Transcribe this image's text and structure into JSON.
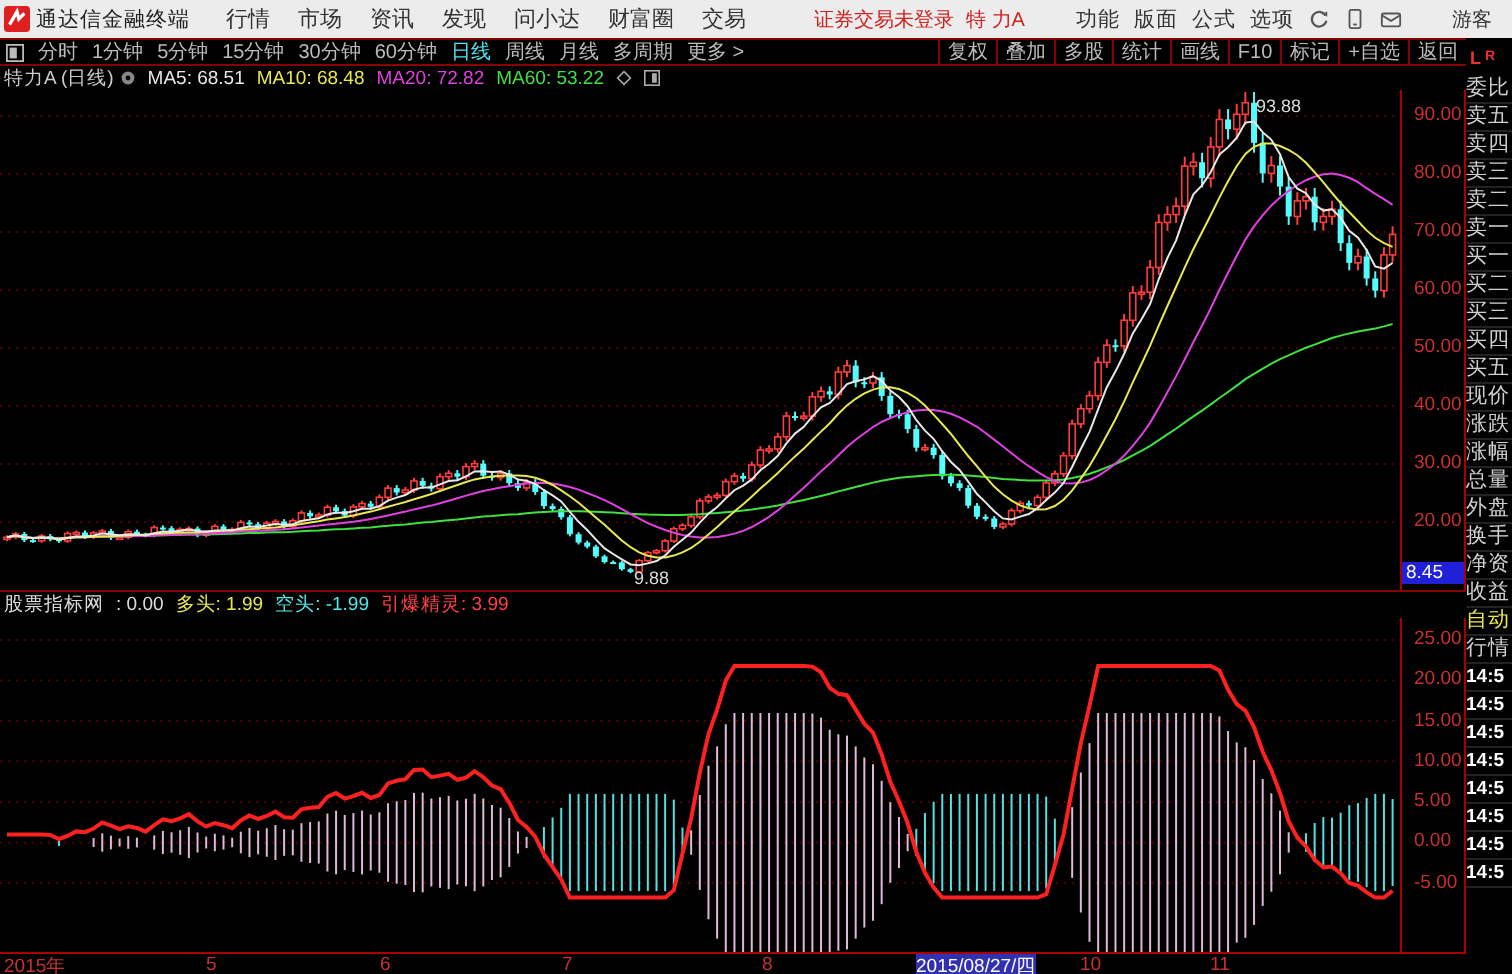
{
  "app": {
    "title": "通达信金融终端"
  },
  "menu": [
    "行情",
    "市场",
    "资讯",
    "发现",
    "问小达",
    "财富圈",
    "交易"
  ],
  "login_status": "证券交易未登录",
  "stock_name": "特 力A",
  "system_menu": [
    "功能",
    "版面",
    "公式",
    "选项"
  ],
  "user": "游客",
  "period_tabs": [
    {
      "label": "分时",
      "selected": false
    },
    {
      "label": "1分钟",
      "selected": false
    },
    {
      "label": "5分钟",
      "selected": false
    },
    {
      "label": "15分钟",
      "selected": false
    },
    {
      "label": "30分钟",
      "selected": false
    },
    {
      "label": "60分钟",
      "selected": false
    },
    {
      "label": "日线",
      "selected": true
    },
    {
      "label": "周线",
      "selected": false
    },
    {
      "label": "月线",
      "selected": false
    },
    {
      "label": "多周期",
      "selected": false
    },
    {
      "label": "更多 >",
      "selected": false
    }
  ],
  "tools": [
    "复权",
    "叠加",
    "多股",
    "统计",
    "画线",
    "F10",
    "标记",
    "+自选",
    "返回"
  ],
  "chart_title": "特力A (日线)",
  "moving_averages": [
    {
      "label": "MA5: 68.51",
      "color": "#e8e8e8"
    },
    {
      "label": "MA10: 68.48",
      "color": "#e8e850"
    },
    {
      "label": "MA20: 72.82",
      "color": "#e040e0"
    },
    {
      "label": "MA60: 53.22",
      "color": "#40e040"
    }
  ],
  "price_axis": [
    "90.00",
    "80.00",
    "70.00",
    "60.00",
    "50.00",
    "40.00",
    "30.00",
    "20.00"
  ],
  "high_label": "93.88",
  "low_label": "9.88",
  "current_price_marker": "8.45",
  "indicator": {
    "name": "股票指标网",
    "value": ": 0.00",
    "lines": [
      {
        "label": "多头: 1.99",
        "color": "#e8e850"
      },
      {
        "label": "空头: -1.99",
        "color": "#50e8e8"
      },
      {
        "label": "引爆精灵: 3.99",
        "color": "#ff4040"
      }
    ],
    "axis": [
      "25.00",
      "20.00",
      "15.00",
      "10.00",
      "5.00",
      "0.00",
      "-5.00"
    ]
  },
  "date_axis": [
    {
      "label": "2015年",
      "selected": false
    },
    {
      "label": "5",
      "selected": false
    },
    {
      "label": "6",
      "selected": false
    },
    {
      "label": "7",
      "selected": false
    },
    {
      "label": "8",
      "selected": false
    },
    {
      "label": "2015/08/27/四",
      "selected": true
    },
    {
      "label": "10",
      "selected": false
    },
    {
      "label": "11",
      "selected": false
    }
  ],
  "side_panel": {
    "logo": [
      "L",
      "R"
    ],
    "items": [
      {
        "label": "委比",
        "kind": "label"
      },
      {
        "label": "卖五",
        "kind": "label"
      },
      {
        "label": "卖四",
        "kind": "label"
      },
      {
        "label": "卖三",
        "kind": "label"
      },
      {
        "label": "卖二",
        "kind": "label"
      },
      {
        "label": "卖一",
        "kind": "label"
      },
      {
        "label": "买一",
        "kind": "label"
      },
      {
        "label": "买二",
        "kind": "label"
      },
      {
        "label": "买三",
        "kind": "label"
      },
      {
        "label": "买四",
        "kind": "label"
      },
      {
        "label": "买五",
        "kind": "label"
      },
      {
        "label": "现价",
        "kind": "label"
      },
      {
        "label": "涨跌",
        "kind": "label"
      },
      {
        "label": "涨幅",
        "kind": "label"
      },
      {
        "label": "总量",
        "kind": "label"
      },
      {
        "label": "外盘",
        "kind": "label"
      },
      {
        "label": "换手",
        "kind": "label"
      },
      {
        "label": "净资",
        "kind": "label"
      },
      {
        "label": "收益",
        "kind": "label"
      },
      {
        "label": "自动",
        "kind": "auto"
      },
      {
        "label": "行情",
        "kind": "label"
      },
      {
        "label": "14:5",
        "kind": "time"
      },
      {
        "label": "14:5",
        "kind": "time"
      },
      {
        "label": "14:5",
        "kind": "time"
      },
      {
        "label": "14:5",
        "kind": "time"
      },
      {
        "label": "14:5",
        "kind": "time"
      },
      {
        "label": "14:5",
        "kind": "time"
      },
      {
        "label": "14:5",
        "kind": "time"
      },
      {
        "label": "14:5",
        "kind": "time"
      }
    ]
  }
}
